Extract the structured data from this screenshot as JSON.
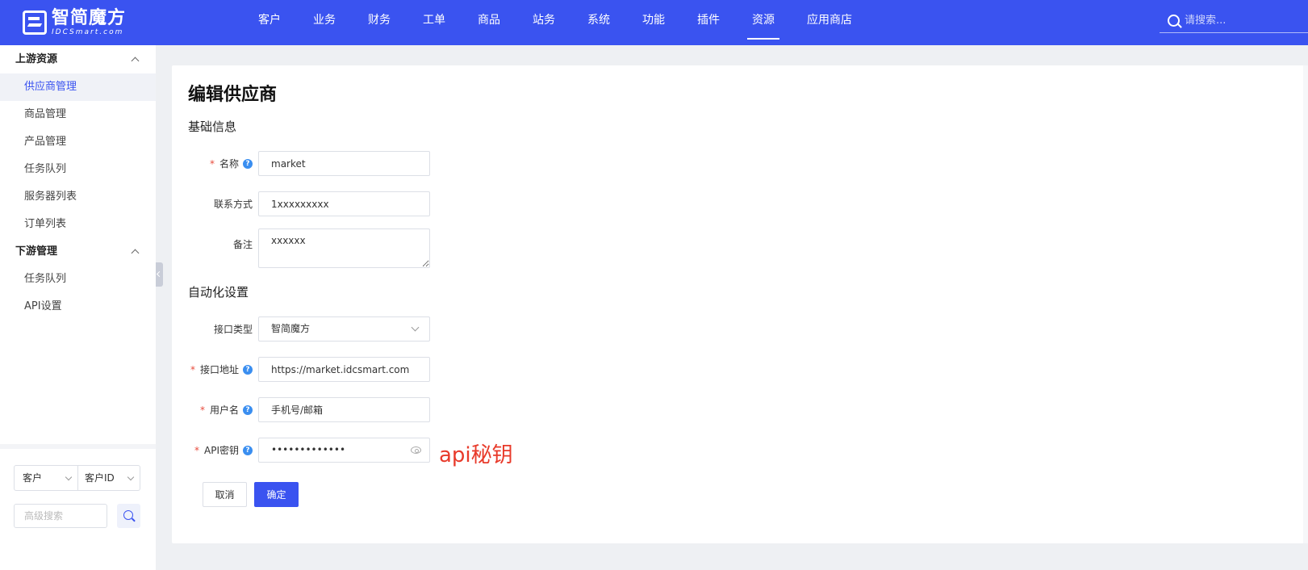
{
  "header": {
    "logo_title": "智简魔方",
    "logo_sub": "IDCSmart.com",
    "nav": [
      "客户",
      "业务",
      "财务",
      "工单",
      "商品",
      "站务",
      "系统",
      "功能",
      "插件",
      "资源",
      "应用商店"
    ],
    "active_nav": "资源",
    "search_placeholder": "请搜索..."
  },
  "sidebar": {
    "groups": [
      {
        "label": "上游资源",
        "items": [
          "供应商管理",
          "商品管理",
          "产品管理",
          "任务队列",
          "服务器列表",
          "订单列表"
        ]
      },
      {
        "label": "下游管理",
        "items": [
          "任务队列",
          "API设置"
        ]
      }
    ],
    "active_item": "供应商管理",
    "filter": {
      "type_selected": "客户",
      "field_selected": "客户ID",
      "placeholder": "高级搜索"
    }
  },
  "main": {
    "title": "编辑供应商",
    "basic_section": "基础信息",
    "auto_section": "自动化设置",
    "fields": {
      "name": {
        "label": "名称",
        "value": "market",
        "required": true,
        "help": "?"
      },
      "contact": {
        "label": "联系方式",
        "value": "1xxxxxxxxx"
      },
      "notes": {
        "label": "备注",
        "value": "xxxxxx"
      },
      "api_type": {
        "label": "接口类型",
        "value": "智简魔方"
      },
      "api_url": {
        "label": "接口地址",
        "value": "https://market.idcsmart.com",
        "required": true,
        "help": "?"
      },
      "username": {
        "label": "用户名",
        "value": "手机号/邮箱",
        "required": true,
        "help": "?"
      },
      "api_key": {
        "label": "API密钥",
        "value": "•••••••••••••",
        "required": true,
        "help": "?"
      }
    },
    "required_mark": "*",
    "annotation": "api秘钥",
    "buttons": {
      "cancel": "取消",
      "ok": "确定"
    }
  },
  "colors": {
    "primary": "#3a53f0",
    "required": "#e84c3d",
    "annotation": "#e83a2a",
    "help": "#3a8ef0"
  }
}
